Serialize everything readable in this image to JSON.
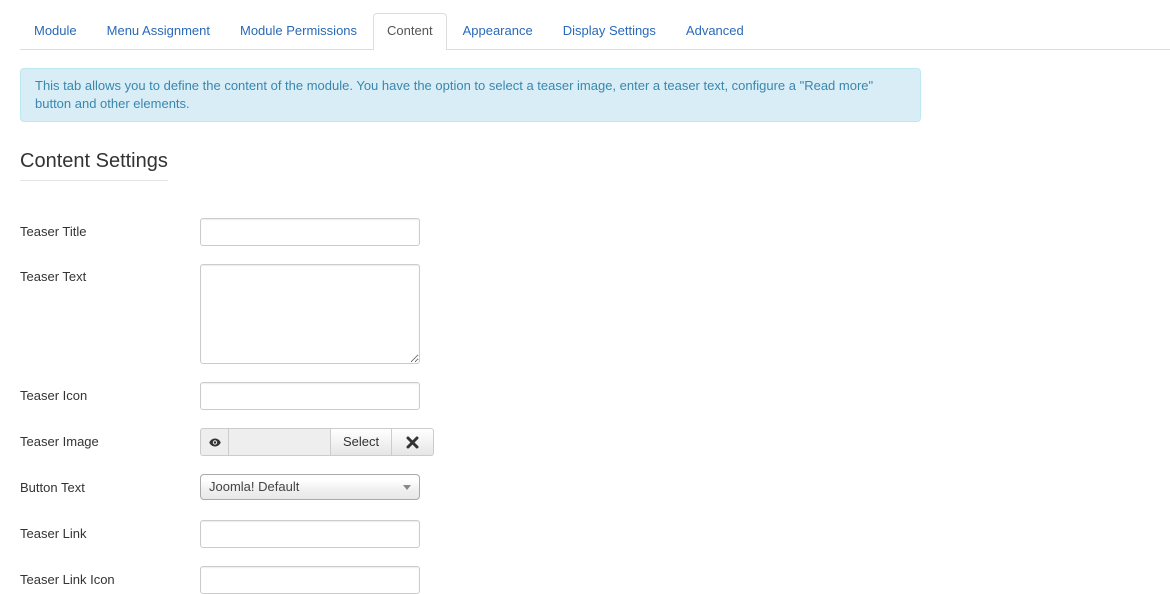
{
  "tabs": [
    {
      "label": "Module",
      "active": false
    },
    {
      "label": "Menu Assignment",
      "active": false
    },
    {
      "label": "Module Permissions",
      "active": false
    },
    {
      "label": "Content",
      "active": true
    },
    {
      "label": "Appearance",
      "active": false
    },
    {
      "label": "Display Settings",
      "active": false
    },
    {
      "label": "Advanced",
      "active": false
    }
  ],
  "alert": {
    "text": "This tab allows you to define the content of the module. You have the option to select a teaser image, enter a teaser text, configure a \"Read more\" button and other elements."
  },
  "section": {
    "title": "Content Settings"
  },
  "fields": {
    "teaser_title": {
      "label": "Teaser Title",
      "value": ""
    },
    "teaser_text": {
      "label": "Teaser Text",
      "value": ""
    },
    "teaser_icon": {
      "label": "Teaser Icon",
      "value": ""
    },
    "teaser_image": {
      "label": "Teaser Image",
      "value": "",
      "select_label": "Select",
      "preview_icon": "eye-icon",
      "clear_icon": "close-icon"
    },
    "button_text": {
      "label": "Button Text",
      "selected": "Joomla! Default"
    },
    "teaser_link": {
      "label": "Teaser Link",
      "value": ""
    },
    "teaser_link_icon": {
      "label": "Teaser Link Icon",
      "value": ""
    }
  },
  "colors": {
    "link": "#2a69b8",
    "alert_bg": "#d9edf7",
    "alert_border": "#bce8f1",
    "alert_text": "#3a87ad"
  }
}
